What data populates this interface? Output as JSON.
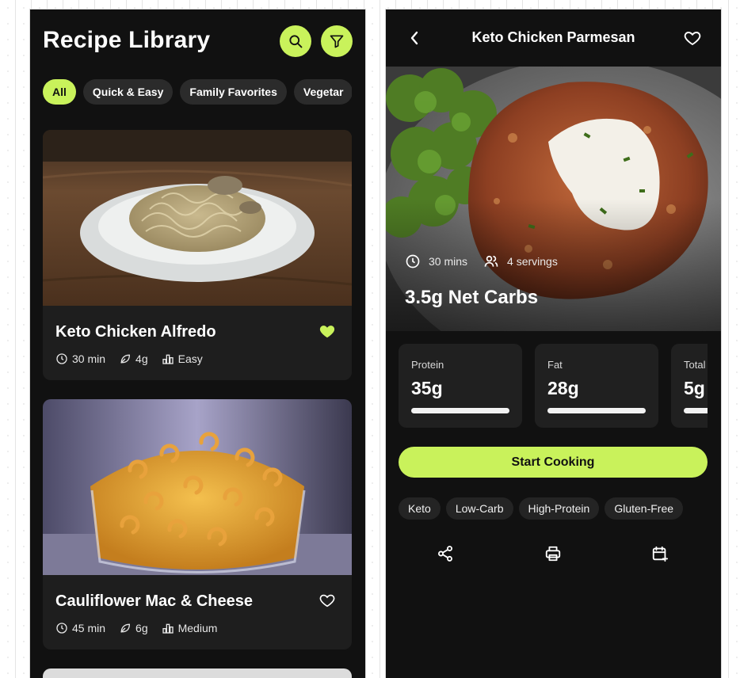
{
  "library": {
    "title": "Recipe Library",
    "header_icons": [
      "search-icon",
      "filter-icon"
    ],
    "chips": [
      "All",
      "Quick & Easy",
      "Family Favorites",
      "Vegetar"
    ],
    "active_chip": "All",
    "recipes": [
      {
        "title": "Keto Chicken Alfredo",
        "time": "30 min",
        "carbs": "4g",
        "difficulty": "Easy",
        "favorited": true
      },
      {
        "title": "Cauliflower Mac & Cheese",
        "time": "45 min",
        "carbs": "6g",
        "difficulty": "Medium",
        "favorited": false
      }
    ]
  },
  "detail": {
    "title": "Keto Chicken Parmesan",
    "time": "30 mins",
    "servings": "4 servings",
    "net_carbs": "3.5g Net Carbs",
    "macros": [
      {
        "label": "Protein",
        "value": "35g",
        "fill": 1.0
      },
      {
        "label": "Fat",
        "value": "28g",
        "fill": 1.0
      },
      {
        "label": "Total",
        "value": "5g",
        "fill": 1.0
      }
    ],
    "start_button": "Start Cooking",
    "tags": [
      "Keto",
      "Low-Carb",
      "High-Protein",
      "Gluten-Free"
    ],
    "actions": [
      "share-icon",
      "print-icon",
      "calendar-add-icon"
    ]
  },
  "colors": {
    "accent": "#c9f25b",
    "screen_bg": "#111111",
    "card_bg": "#1e1e1e"
  }
}
